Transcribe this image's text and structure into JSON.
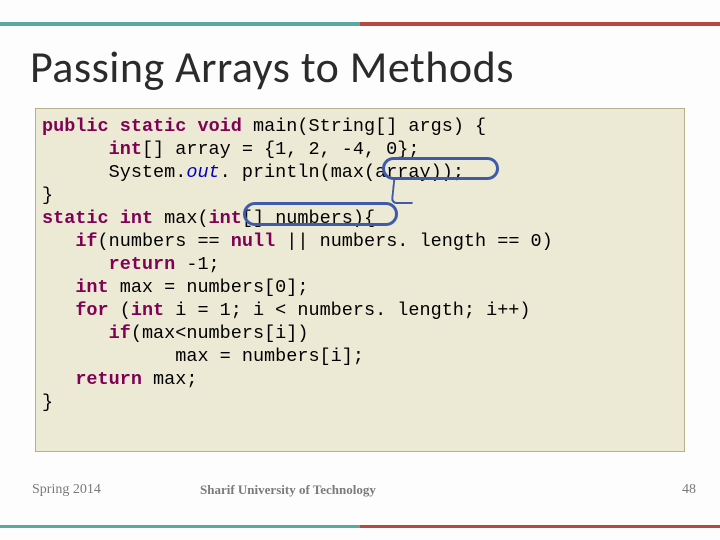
{
  "title": "Passing Arrays to Methods",
  "code": {
    "l1": {
      "kw_public": "public",
      "kw_static": "static",
      "kw_void": "void",
      "main": "main(String[] args) {"
    },
    "l2": {
      "kw_int": "int",
      "rest": "[] array = {1, 2, -4, 0};"
    },
    "l3": {
      "sys": "System.",
      "out": "out",
      "dot_println": ". println(",
      "call": "max(array)",
      "close": ");"
    },
    "l4": {
      "brace": "}"
    },
    "l5": {
      "kw_static": "static",
      "kw_int": "int",
      "name": "max(",
      "param_kw": "int",
      "param_rest": "[] numbers",
      "after": "){"
    },
    "l6": {
      "kw_if": "if",
      "cond": "(numbers == ",
      "kw_null": "null",
      "mid": " || numbers. length == 0)"
    },
    "l7": {
      "kw_return": "return",
      "val": " -1;"
    },
    "l8": {
      "kw_int": "int",
      "rest": " max = numbers[0];"
    },
    "l9": {
      "kw_for": "for",
      "open": " (",
      "kw_int": "int",
      "rest": " i = 1; i < numbers. length; i++)"
    },
    "l10": {
      "kw_if": "if",
      "cond": "(max<numbers[i])"
    },
    "l11": {
      "stmt": "max = numbers[i];"
    },
    "l12": {
      "kw_return": "return",
      "rest": " max;"
    },
    "l13": {
      "brace": "}"
    }
  },
  "footer": {
    "left": "Spring 2014",
    "center": "Sharif University of Technology",
    "right": "48"
  }
}
